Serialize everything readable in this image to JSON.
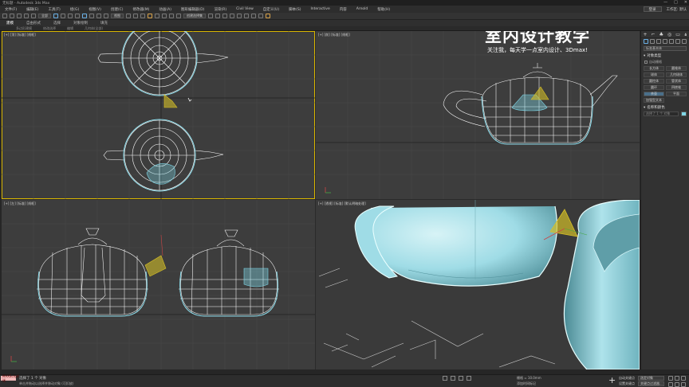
{
  "window": {
    "title": "无标题 - Autodesk 3ds Max"
  },
  "menu": [
    "文件(F)",
    "编辑(E)",
    "工具(T)",
    "组(G)",
    "视图(V)",
    "创建(C)",
    "修改器(M)",
    "动画(A)",
    "图形编辑器(D)",
    "渲染(R)",
    "Civil View",
    "自定义(U)",
    "脚本(S)",
    "Interactive",
    "内容",
    "Arnold",
    "帮助(H)"
  ],
  "signin": {
    "user": "登录",
    "workspace": "工作区: 默认"
  },
  "toolbar": {
    "filter_all": "全部",
    "view_ref": "视图",
    "named_sel": "创建选择集"
  },
  "ribbon": {
    "tabs": [
      "建模",
      "自由形式",
      "选择",
      "对象绘制",
      "填充"
    ],
    "sub": [
      "多边形建模",
      "修改选择",
      "编辑",
      "几何体(全部)"
    ]
  },
  "viewports": {
    "top": "[+] [顶] [标准] [线框]",
    "front": "[+] [前] [标准] [线框]",
    "left": "[+] [左] [标准] [线框]",
    "persp": "[+] [透视] [标准] [默认明暗处理]"
  },
  "watermark": {
    "title": "室内设计教学",
    "subtitle": "关注我，每天学一点室内设计、3Dmax!"
  },
  "command_panel": {
    "tabs": [
      "+",
      "⌐",
      "♣",
      "◎",
      "▭",
      "ۃ"
    ],
    "category": "标准基本体",
    "rollout_object_type": "对象类型",
    "autogrid": "自动栅格",
    "objects": [
      "长方体",
      "圆锥体",
      "球体",
      "几何球体",
      "圆柱体",
      "管状体",
      "圆环",
      "四棱锥",
      "茶壶",
      "平面",
      "加强型文本",
      ""
    ],
    "rollout_name_color": "名称和颜色",
    "name_value": "选择了 1 个 对象",
    "swatch_color": "#7fd6e6"
  },
  "status": {
    "maxscript": "MAXScript 迷",
    "line1": "选择了 1 个 对象",
    "line2": "单击并拖动以选择并移动对象 (可扣放)",
    "grid": "栅格 = 10.0mm",
    "time_tag": "添加时间标记",
    "auto_key": "自动关键点",
    "set_key": "设置关键点",
    "auto_sel": "选定对象",
    "key_filter": "关键点过滤器..."
  }
}
